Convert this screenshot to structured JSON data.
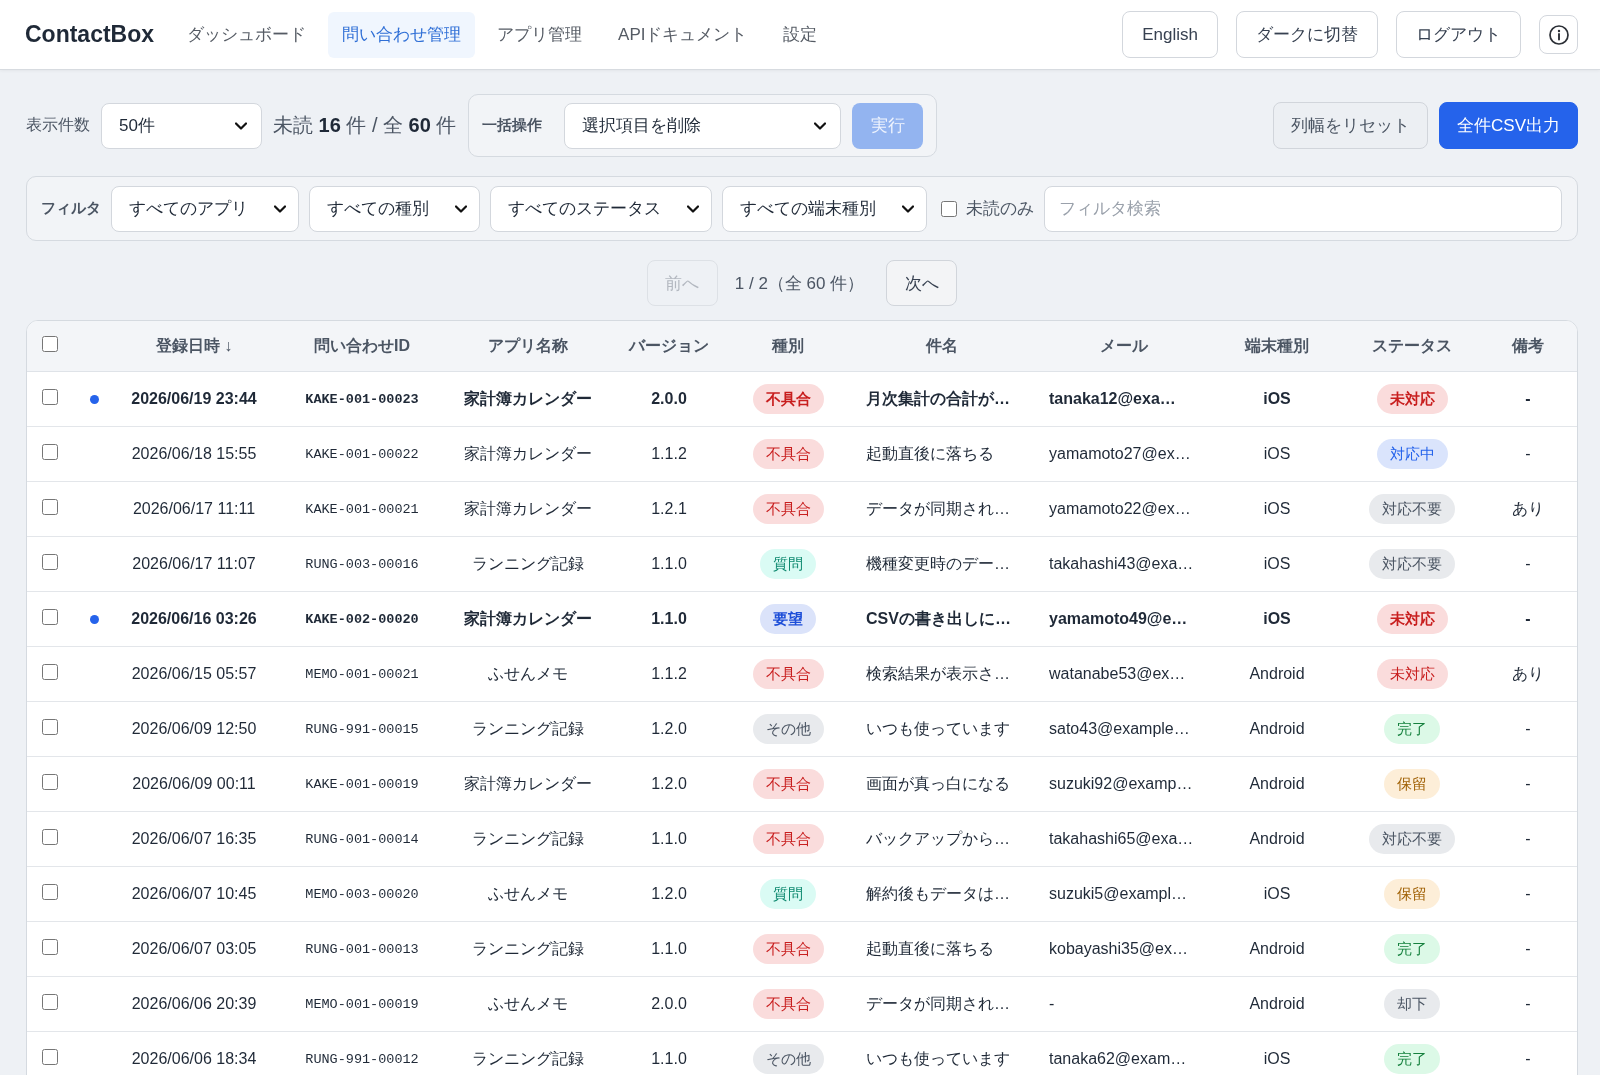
{
  "header": {
    "logo": "ContactBox",
    "nav": [
      {
        "label": "ダッシュボード",
        "selected": false
      },
      {
        "label": "問い合わせ管理",
        "selected": true
      },
      {
        "label": "アプリ管理",
        "selected": false
      },
      {
        "label": "APIドキュメント",
        "selected": false
      },
      {
        "label": "設定",
        "selected": false
      }
    ],
    "language_button": "English",
    "theme_button": "ダークに切替",
    "logout_button": "ログアウト"
  },
  "toolbar": {
    "page_size_label": "表示件数",
    "page_size": "50件",
    "summary": "未読 **16** 件 / 全 **60** 件",
    "bulk": {
      "label": "一括操作",
      "action": "選択項目を削除",
      "run": {
        "label": "実行",
        "disabled": true
      }
    },
    "reset_columns": "列幅をリセット",
    "export_csv": "全件CSV出力"
  },
  "filters": {
    "label": "フィルタ",
    "dropdowns": [
      "すべてのアプリ",
      "すべての種別",
      "すべてのステータス",
      "すべての端末種別"
    ],
    "unread_only": {
      "label": "未読のみ",
      "checked": false
    },
    "search": {
      "placeholder": "フィルタ検索"
    }
  },
  "pagination": {
    "prev": {
      "label": "前へ",
      "disabled": true
    },
    "info": "1 / 2（全 60 件）",
    "next": {
      "label": "次へ",
      "disabled": false
    }
  },
  "table": {
    "select_all": {
      "checked": false
    },
    "columns": [
      "登録日時 ↓",
      "問い合わせID",
      "アプリ名称",
      "バージョン",
      "種別",
      "件名",
      "メール",
      "端末種別",
      "ステータス",
      "備考"
    ],
    "rows": [
      {
        "checked": false,
        "unread": true,
        "date": "2026/06/19 23:44",
        "id": "KAKE-001-00023",
        "app": "家計簿カレンダー",
        "version": "2.0.0",
        "type": {
          "text": "不具合",
          "color": "#c81e1e"
        },
        "subject": "月次集計の合計が…",
        "email": "tanaka12@exa…",
        "device": "iOS",
        "status": {
          "text": "未対応",
          "color": "#c81e1e"
        },
        "note": "-"
      },
      {
        "checked": false,
        "unread": false,
        "date": "2026/06/18 15:55",
        "id": "KAKE-001-00022",
        "app": "家計簿カレンダー",
        "version": "1.1.2",
        "type": {
          "text": "不具合",
          "color": "#c81e1e"
        },
        "subject": "起動直後に落ちる",
        "email": "yamamoto27@ex…",
        "device": "iOS",
        "status": {
          "text": "対応中",
          "color": "#2563eb"
        },
        "note": "-"
      },
      {
        "checked": false,
        "unread": false,
        "date": "2026/06/17 11:11",
        "id": "KAKE-001-00021",
        "app": "家計簿カレンダー",
        "version": "1.2.1",
        "type": {
          "text": "不具合",
          "color": "#c81e1e"
        },
        "subject": "データが同期され…",
        "email": "yamamoto22@ex…",
        "device": "iOS",
        "status": {
          "text": "対応不要",
          "color": "#4b5563"
        },
        "note": "あり"
      },
      {
        "checked": false,
        "unread": false,
        "date": "2026/06/17 11:07",
        "id": "RUNG-003-00016",
        "app": "ランニング記録",
        "version": "1.1.0",
        "type": {
          "text": "質問",
          "color": "#0f8a70"
        },
        "subject": "機種変更時のデー…",
        "email": "takahashi43@exa…",
        "device": "iOS",
        "status": {
          "text": "対応不要",
          "color": "#4b5563"
        },
        "note": "-"
      },
      {
        "checked": false,
        "unread": true,
        "date": "2026/06/16 03:26",
        "id": "KAKE-002-00020",
        "app": "家計簿カレンダー",
        "version": "1.1.0",
        "type": {
          "text": "要望",
          "color": "#1d4ed8"
        },
        "subject": "CSVの書き出しに…",
        "email": "yamamoto49@e…",
        "device": "iOS",
        "status": {
          "text": "未対応",
          "color": "#c81e1e"
        },
        "note": "-"
      },
      {
        "checked": false,
        "unread": false,
        "date": "2026/06/15 05:57",
        "id": "MEMO-001-00021",
        "app": "ふせんメモ",
        "version": "1.1.2",
        "type": {
          "text": "不具合",
          "color": "#c81e1e"
        },
        "subject": "検索結果が表示さ…",
        "email": "watanabe53@ex…",
        "device": "Android",
        "status": {
          "text": "未対応",
          "color": "#c81e1e"
        },
        "note": "あり"
      },
      {
        "checked": false,
        "unread": false,
        "date": "2026/06/09 12:50",
        "id": "RUNG-991-00015",
        "app": "ランニング記録",
        "version": "1.2.0",
        "type": {
          "text": "その他",
          "color": "#4b5563"
        },
        "subject": "いつも使っています",
        "email": "sato43@example…",
        "device": "Android",
        "status": {
          "text": "完了",
          "color": "#15803d"
        },
        "note": "-"
      },
      {
        "checked": false,
        "unread": false,
        "date": "2026/06/09 00:11",
        "id": "KAKE-001-00019",
        "app": "家計簿カレンダー",
        "version": "1.2.0",
        "type": {
          "text": "不具合",
          "color": "#c81e1e"
        },
        "subject": "画面が真っ白になる",
        "email": "suzuki92@examp…",
        "device": "Android",
        "status": {
          "text": "保留",
          "color": "#a16207"
        },
        "note": "-"
      },
      {
        "checked": false,
        "unread": false,
        "date": "2026/06/07 16:35",
        "id": "RUNG-001-00014",
        "app": "ランニング記録",
        "version": "1.1.0",
        "type": {
          "text": "不具合",
          "color": "#c81e1e"
        },
        "subject": "バックアップから…",
        "email": "takahashi65@exa…",
        "device": "Android",
        "status": {
          "text": "対応不要",
          "color": "#4b5563"
        },
        "note": "-"
      },
      {
        "checked": false,
        "unread": false,
        "date": "2026/06/07 10:45",
        "id": "MEMO-003-00020",
        "app": "ふせんメモ",
        "version": "1.2.0",
        "type": {
          "text": "質問",
          "color": "#0f8a70"
        },
        "subject": "解約後もデータは…",
        "email": "suzuki5@exampl…",
        "device": "iOS",
        "status": {
          "text": "保留",
          "color": "#a16207"
        },
        "note": "-"
      },
      {
        "checked": false,
        "unread": false,
        "date": "2026/06/07 03:05",
        "id": "RUNG-001-00013",
        "app": "ランニング記録",
        "version": "1.1.0",
        "type": {
          "text": "不具合",
          "color": "#c81e1e"
        },
        "subject": "起動直後に落ちる",
        "email": "kobayashi35@ex…",
        "device": "Android",
        "status": {
          "text": "完了",
          "color": "#15803d"
        },
        "note": "-"
      },
      {
        "checked": false,
        "unread": false,
        "date": "2026/06/06 20:39",
        "id": "MEMO-001-00019",
        "app": "ふせんメモ",
        "version": "2.0.0",
        "type": {
          "text": "不具合",
          "color": "#c81e1e"
        },
        "subject": "データが同期され…",
        "email": "-",
        "device": "Android",
        "status": {
          "text": "却下",
          "color": "#4b5563"
        },
        "note": "-"
      },
      {
        "checked": false,
        "unread": false,
        "date": "2026/06/06 18:34",
        "id": "RUNG-991-00012",
        "app": "ランニング記録",
        "version": "1.1.0",
        "type": {
          "text": "その他",
          "color": "#4b5563"
        },
        "subject": "いつも使っています",
        "email": "tanaka62@exam…",
        "device": "iOS",
        "status": {
          "text": "完了",
          "color": "#15803d"
        },
        "note": "-"
      }
    ]
  }
}
